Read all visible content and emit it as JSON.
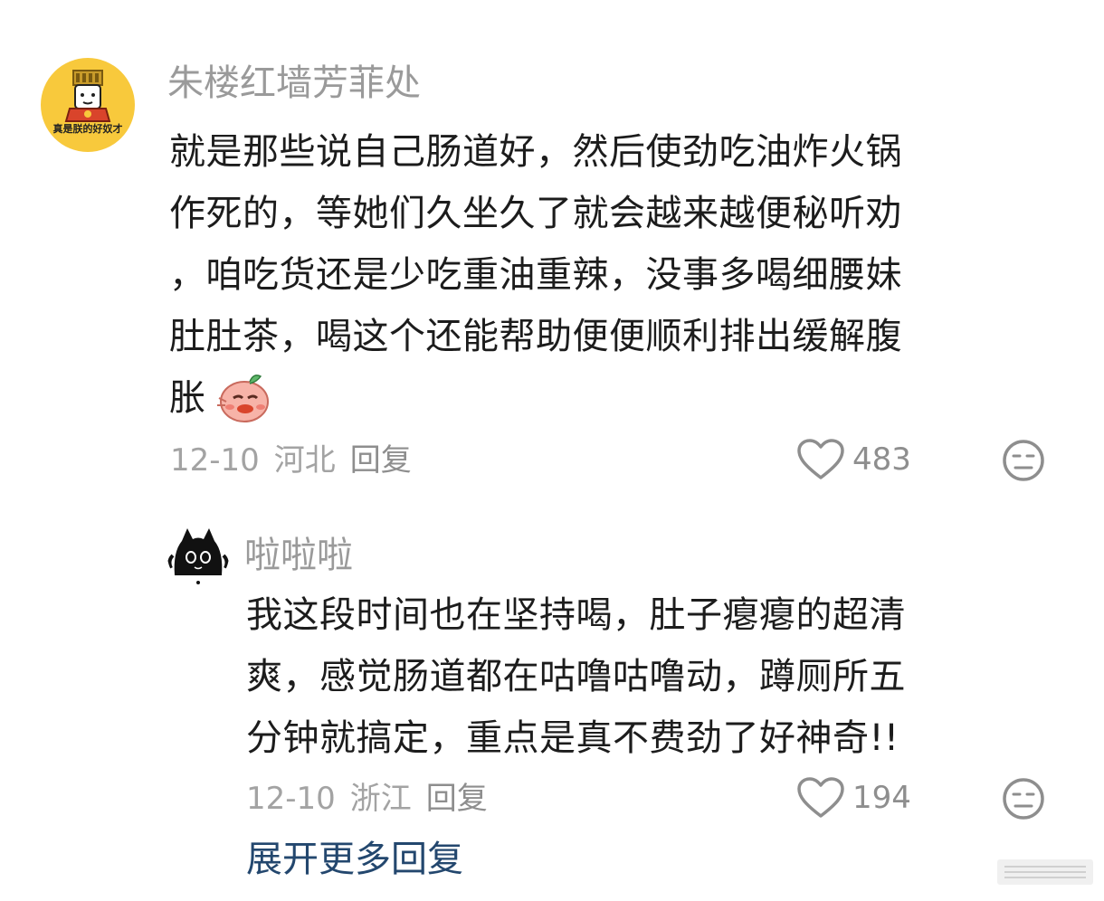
{
  "comment": {
    "avatar_icon": "emperor-cartoon-avatar",
    "avatar_badge": "真是朕的好奴才",
    "username": "朱楼红墙芳菲处",
    "text_lines": [
      "就是那些说自己肠道好，然后使劲吃油炸火锅",
      "作死的，等她们久坐久了就会越来越便秘听劝",
      "，咱吃货还是少吃重油重辣，没事多喝细腰妹",
      "肚肚茶，喝这个还能帮助便便顺利排出缓解腹",
      "胀"
    ],
    "emoji": "blushing-sprout-emoji",
    "date": "12-10",
    "location": "河北",
    "reply_label": "回复",
    "likes": "483",
    "like_icon": "heart-outline-icon",
    "react_icon": "meh-face-icon"
  },
  "reply": {
    "avatar_icon": "black-cat-avatar",
    "username": "啦啦啦",
    "text_lines": [
      "我这段时间也在坚持喝，肚子瘪瘪的超清",
      "爽，感觉肠道都在咕噜咕噜动，蹲厕所五",
      "分钟就搞定，重点是真不费劲了好神奇!!"
    ],
    "date": "12-10",
    "location": "浙江",
    "reply_label": "回复",
    "likes": "194",
    "like_icon": "heart-outline-icon",
    "react_icon": "meh-face-icon"
  },
  "expand_more": "展开更多回复",
  "colors": {
    "avatar_bg": "#f8c93c",
    "username": "#9a9a9a",
    "text": "#1c1c1c",
    "meta": "#a3a3a3",
    "link": "#23476e"
  }
}
